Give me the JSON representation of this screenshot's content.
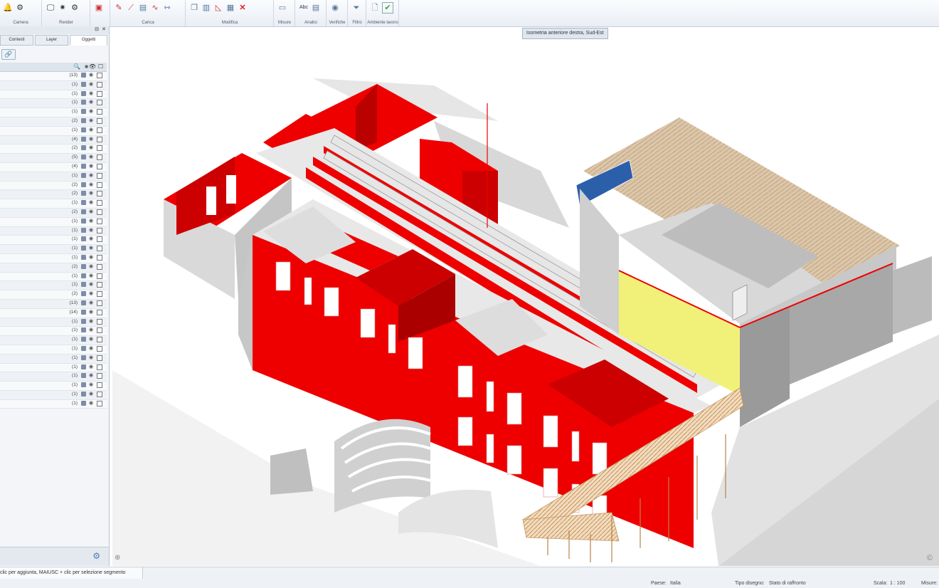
{
  "ribbon": {
    "groups": [
      {
        "label": "Camera",
        "icons": [
          "settings-bell-icon",
          "people-icon"
        ]
      },
      {
        "label": "Render",
        "icons": [
          "monitor-icon",
          "sun-icon",
          "gear-icon"
        ]
      },
      {
        "label": "",
        "icons": [
          "save-icon"
        ]
      },
      {
        "label": "Carica",
        "icons": [
          "pencil-icon",
          "pipe-icon",
          "stack-icon",
          "wave-icon",
          "dimension-icon"
        ]
      },
      {
        "label": "Modifica",
        "icons": [
          "copy-icon",
          "pillar-icon",
          "ramp-icon",
          "chart-icon",
          "delete-icon"
        ]
      },
      {
        "label": "Misure",
        "icons": [
          "ruler-icon"
        ]
      },
      {
        "label": "Analisi",
        "icons": [
          "text-icon",
          "table-icon"
        ]
      },
      {
        "label": "Verifiche",
        "icons": [
          "pin-icon"
        ]
      },
      {
        "label": "Filtro",
        "icons": [
          "filter-icon"
        ]
      },
      {
        "label": "Ambiente lavoro",
        "icons": [
          "document-icon",
          "checkbox-icon"
        ]
      }
    ],
    "text_icon_glyph": "Abc"
  },
  "left_panel": {
    "tabs": [
      {
        "label": "Contesti",
        "active": false
      },
      {
        "label": "Layer",
        "active": false
      },
      {
        "label": "Oggetti",
        "active": true
      }
    ],
    "rows": [
      {
        "count": "(13)"
      },
      {
        "count": "(1)"
      },
      {
        "count": "(1)"
      },
      {
        "count": "(1)"
      },
      {
        "count": "(1)"
      },
      {
        "count": "(2)"
      },
      {
        "count": "(1)"
      },
      {
        "count": "(4)"
      },
      {
        "count": "(2)"
      },
      {
        "count": "(5)"
      },
      {
        "count": "(4)"
      },
      {
        "count": "(1)"
      },
      {
        "count": "(2)"
      },
      {
        "count": "(2)"
      },
      {
        "count": "(1)"
      },
      {
        "count": "(2)"
      },
      {
        "count": "(1)"
      },
      {
        "count": "(1)"
      },
      {
        "count": "(1)"
      },
      {
        "count": "(1)"
      },
      {
        "count": "(1)"
      },
      {
        "count": "(2)"
      },
      {
        "count": "(1)"
      },
      {
        "count": "(1)"
      },
      {
        "count": "(2)"
      },
      {
        "count": "(13)"
      },
      {
        "count": "(14)"
      },
      {
        "count": "(1)"
      },
      {
        "count": "(1)"
      },
      {
        "count": "(1)"
      },
      {
        "count": "(1)"
      },
      {
        "count": "(1)"
      },
      {
        "count": "(1)"
      },
      {
        "count": "(1)"
      },
      {
        "count": "(1)"
      },
      {
        "count": "(1)"
      },
      {
        "count": "(1)"
      }
    ]
  },
  "viewport": {
    "view_label": "Isometria anteriore destra, Sud-Est"
  },
  "status_bar": {
    "hint": "clic per aggiunta, MAIUSC + clic per selezione segmento",
    "paese_label": "Paese:",
    "paese_value": "Italia",
    "tipo_label": "Tipo disegno:",
    "tipo_value": "Stato di raffronto",
    "scala_label": "Scala:",
    "scala_value": "1 : 100",
    "misure_label": "Misure:"
  },
  "colors": {
    "wall_red": "#e60000",
    "dark_red": "#b00000",
    "roof_tile": "#d9c3a5",
    "ribbon_bg": "#edf1f6"
  }
}
